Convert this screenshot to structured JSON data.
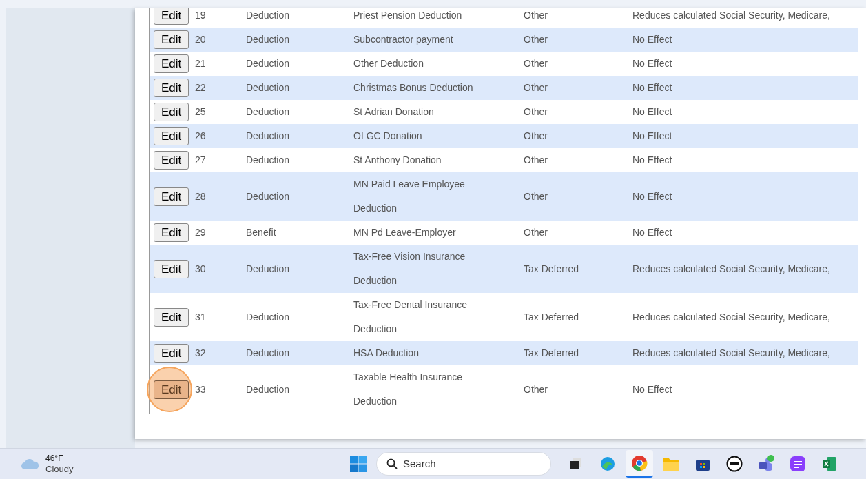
{
  "table": {
    "rows": [
      {
        "action": "Edit",
        "action_highlighted": false,
        "id": "19",
        "type": "Deduction",
        "name": "Priest Pension Deduction",
        "category": "Other",
        "effect": "Reduces calculated Social Security, Medicare,"
      },
      {
        "action": "Edit",
        "action_highlighted": false,
        "id": "20",
        "type": "Deduction",
        "name": "Subcontractor payment",
        "category": "Other",
        "effect": "No Effect"
      },
      {
        "action": "Edit",
        "action_highlighted": false,
        "id": "21",
        "type": "Deduction",
        "name": "Other Deduction",
        "category": "Other",
        "effect": "No Effect"
      },
      {
        "action": "Edit",
        "action_highlighted": false,
        "id": "22",
        "type": "Deduction",
        "name": "Christmas Bonus Deduction",
        "category": "Other",
        "effect": "No Effect"
      },
      {
        "action": "Edit",
        "action_highlighted": false,
        "id": "25",
        "type": "Deduction",
        "name": "St Adrian Donation",
        "category": "Other",
        "effect": "No Effect"
      },
      {
        "action": "Edit",
        "action_highlighted": false,
        "id": "26",
        "type": "Deduction",
        "name": "OLGC Donation",
        "category": "Other",
        "effect": "No Effect"
      },
      {
        "action": "Edit",
        "action_highlighted": false,
        "id": "27",
        "type": "Deduction",
        "name": "St Anthony Donation",
        "category": "Other",
        "effect": "No Effect"
      },
      {
        "action": "Edit",
        "action_highlighted": false,
        "id": "28",
        "type": "Deduction",
        "name": "MN Paid Leave Employee Deduction",
        "category": "Other",
        "effect": "No Effect"
      },
      {
        "action": "Edit",
        "action_highlighted": false,
        "id": "29",
        "type": "Benefit",
        "name": "MN Pd Leave-Employer",
        "category": "Other",
        "effect": "No Effect"
      },
      {
        "action": "Edit",
        "action_highlighted": false,
        "id": "30",
        "type": "Deduction",
        "name": "Tax-Free Vision Insurance Deduction",
        "category": "Tax Deferred",
        "effect": "Reduces calculated Social Security, Medicare,"
      },
      {
        "action": "Edit",
        "action_highlighted": false,
        "id": "31",
        "type": "Deduction",
        "name": "Tax-Free Dental Insurance Deduction",
        "category": "Tax Deferred",
        "effect": "Reduces calculated Social Security, Medicare,"
      },
      {
        "action": "Edit",
        "action_highlighted": false,
        "id": "32",
        "type": "Deduction",
        "name": "HSA Deduction",
        "category": "Tax Deferred",
        "effect": "Reduces calculated Social Security, Medicare,"
      },
      {
        "action": "Edit",
        "action_highlighted": true,
        "id": "33",
        "type": "Deduction",
        "name": "Taxable Health Insurance Deduction",
        "category": "Other",
        "effect": "No Effect"
      }
    ]
  },
  "taskbar": {
    "weather": {
      "temperature": "46°F",
      "condition": "Cloudy"
    },
    "search": {
      "placeholder": "Search"
    },
    "apps": [
      {
        "kind": "taskview",
        "active": false
      },
      {
        "kind": "edge",
        "active": false
      },
      {
        "kind": "chrome",
        "active": true
      },
      {
        "kind": "files",
        "active": false
      },
      {
        "kind": "store",
        "active": false
      },
      {
        "kind": "dell",
        "active": false
      },
      {
        "kind": "teams",
        "active": false
      },
      {
        "kind": "purple",
        "active": false
      },
      {
        "kind": "excel",
        "active": false
      }
    ]
  }
}
